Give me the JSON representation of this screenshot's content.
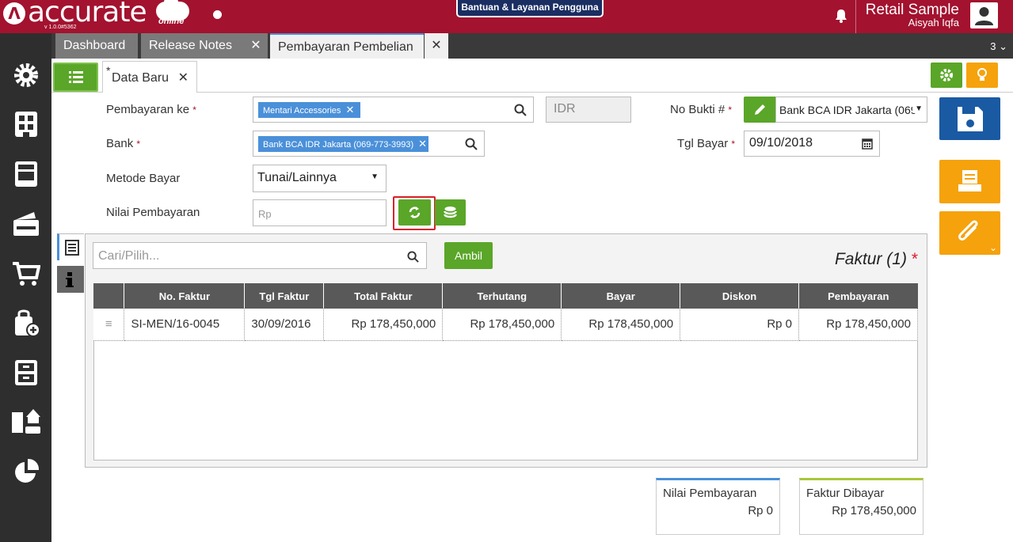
{
  "header": {
    "logo_text": "accurate",
    "logo_sub": "online",
    "version": "v 1.0.0#5362",
    "help_button": "Bantuan & Layanan Pengguna",
    "company": "Retail Sample",
    "user": "Aisyah Iqfa",
    "brand_color": "#a3122f"
  },
  "tabs": [
    {
      "label": "Dashboard"
    },
    {
      "label": "Release Notes"
    },
    {
      "label": "Pembayaran Pembelian",
      "active": true
    }
  ],
  "tab_count": "3",
  "subtab": {
    "star": "*",
    "label": "Data Baru"
  },
  "form": {
    "pembayaran_ke_label": "Pembayaran ke",
    "pembayaran_ke_value": "Mentari Accessories",
    "currency": "IDR",
    "bank_label": "Bank",
    "bank_value": "Bank BCA IDR Jakarta (069-773-3993)",
    "metode_label": "Metode Bayar",
    "metode_value": "Tunai/Lainnya",
    "nilai_label": "Nilai Pembayaran",
    "nilai_placeholder": "Rp",
    "no_bukti_label": "No Bukti #",
    "no_bukti_value": "Bank BCA IDR Jakarta (069",
    "tgl_label": "Tgl Bayar",
    "tgl_value": "09/10/2018",
    "required_mark": "*"
  },
  "panel": {
    "search_placeholder": "Cari/Pilih...",
    "ambil_label": "Ambil",
    "title": "Faktur (1)",
    "required_mark": "*",
    "columns": [
      "No. Faktur",
      "Tgl Faktur",
      "Total Faktur",
      "Terhutang",
      "Bayar",
      "Diskon",
      "Pembayaran"
    ],
    "rows": [
      {
        "no": "SI-MEN/16-0045",
        "tgl": "30/09/2016",
        "total": "Rp 178,450,000",
        "terhutang": "Rp 178,450,000",
        "bayar": "Rp 178,450,000",
        "diskon": "Rp 0",
        "pembayaran": "Rp 178,450,000"
      }
    ]
  },
  "summary": {
    "nilai_label": "Nilai Pembayaran",
    "nilai_value": "Rp 0",
    "faktur_label": "Faktur Dibayar",
    "faktur_value": "Rp 178,450,000"
  }
}
